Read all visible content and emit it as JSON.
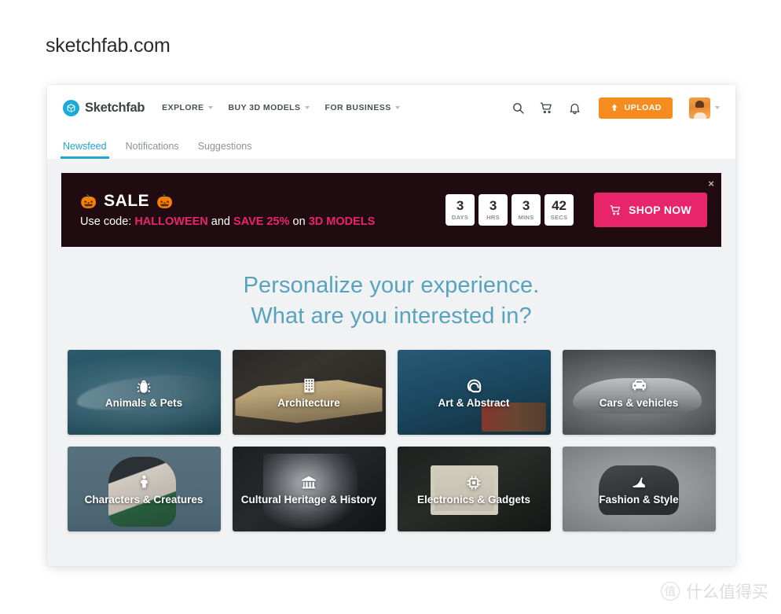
{
  "page": {
    "title": "sketchfab.com"
  },
  "header": {
    "brand": "Sketchfab",
    "brand_icon": "cube-logo-icon",
    "nav": [
      {
        "label": "EXPLORE",
        "icon": "chevron-down-icon"
      },
      {
        "label": "BUY 3D MODELS",
        "icon": "chevron-down-icon"
      },
      {
        "label": "FOR BUSINESS",
        "icon": "chevron-down-icon"
      }
    ],
    "actions": {
      "search_icon": "search-icon",
      "cart_icon": "shopping-cart-icon",
      "notifications_icon": "bell-icon",
      "upload_label": "UPLOAD",
      "upload_icon": "upload-arrow-icon",
      "upload_color": "#f68b1f",
      "avatar_icon": "user-avatar",
      "avatar_caret_icon": "chevron-down-icon"
    }
  },
  "tabs": {
    "active_color": "#1fa7cc",
    "items": [
      {
        "label": "Newsfeed",
        "active": true
      },
      {
        "label": "Notifications",
        "active": false
      },
      {
        "label": "Suggestions",
        "active": false
      }
    ]
  },
  "banner": {
    "background": "#200c10",
    "pumpkin_left": "🎃",
    "pumpkin_right": "🎃",
    "sale_word": "SALE",
    "promo_prefix": "Use code:",
    "promo_code": "HALLOWEEN",
    "promo_and": "and",
    "promo_discount": "SAVE 25%",
    "promo_on": "on",
    "promo_target": "3D MODELS",
    "highlight_color": "#e8246b",
    "close_label": "×",
    "countdown": [
      {
        "value": "3",
        "unit": "DAYS"
      },
      {
        "value": "3",
        "unit": "HRS"
      },
      {
        "value": "3",
        "unit": "MINS"
      },
      {
        "value": "42",
        "unit": "SECS"
      }
    ],
    "shop_label": "SHOP NOW",
    "shop_icon": "shopping-cart-icon",
    "shop_color": "#e8246b"
  },
  "personalize": {
    "line1": "Personalize your experience.",
    "line2": "What are you interested in?",
    "color": "#57a3bd"
  },
  "categories": [
    {
      "label": "Animals & Pets",
      "icon": "bug-icon"
    },
    {
      "label": "Architecture",
      "icon": "building-icon"
    },
    {
      "label": "Art & Abstract",
      "icon": "spiral-icon"
    },
    {
      "label": "Cars & vehicles",
      "icon": "car-icon"
    },
    {
      "label": "Characters & Creatures",
      "icon": "person-icon"
    },
    {
      "label": "Cultural Heritage & History",
      "icon": "museum-icon"
    },
    {
      "label": "Electronics & Gadgets",
      "icon": "microchip-icon"
    },
    {
      "label": "Fashion & Style",
      "icon": "high-heel-icon"
    }
  ],
  "watermark": {
    "mark": "值",
    "text": "什么值得买"
  }
}
